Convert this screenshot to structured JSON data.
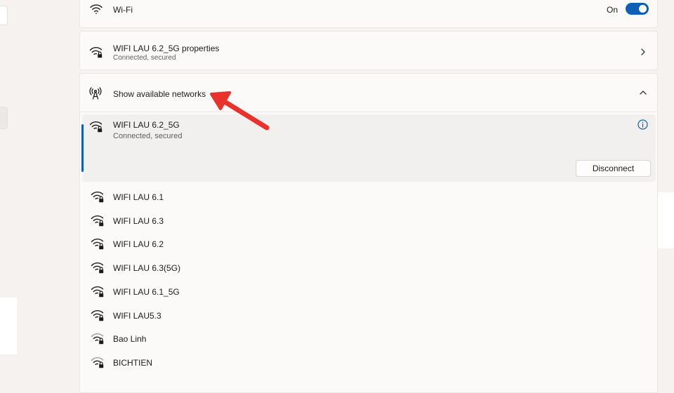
{
  "wifi": {
    "label": "Wi-Fi",
    "toggle_state": "On"
  },
  "properties": {
    "title": "WIFI LAU 6.2_5G properties",
    "status": "Connected, secured"
  },
  "available": {
    "label": "Show available networks"
  },
  "connected_network": {
    "name": "WIFI LAU 6.2_5G",
    "status": "Connected, secured",
    "disconnect_label": "Disconnect"
  },
  "networks": [
    {
      "name": "WIFI LAU 6.1"
    },
    {
      "name": "WIFI LAU 6.3"
    },
    {
      "name": "WIFI LAU 6.2"
    },
    {
      "name": "WIFI LAU 6.3(5G)"
    },
    {
      "name": "WIFI LAU 6.1_5G"
    },
    {
      "name": "WIFI LAU5.3"
    },
    {
      "name": "Bao Linh"
    },
    {
      "name": "BICHTIEN"
    }
  ],
  "icons": {
    "wifi": "wifi-icon",
    "secured_wifi": "wifi-lock-icon",
    "antenna": "antenna-icon",
    "chevron_right": "chevron-right-icon",
    "chevron_up": "chevron-up-icon",
    "info": "info-icon"
  },
  "colors": {
    "accent": "#0f5fb8",
    "annotation_arrow": "#e8322b"
  }
}
